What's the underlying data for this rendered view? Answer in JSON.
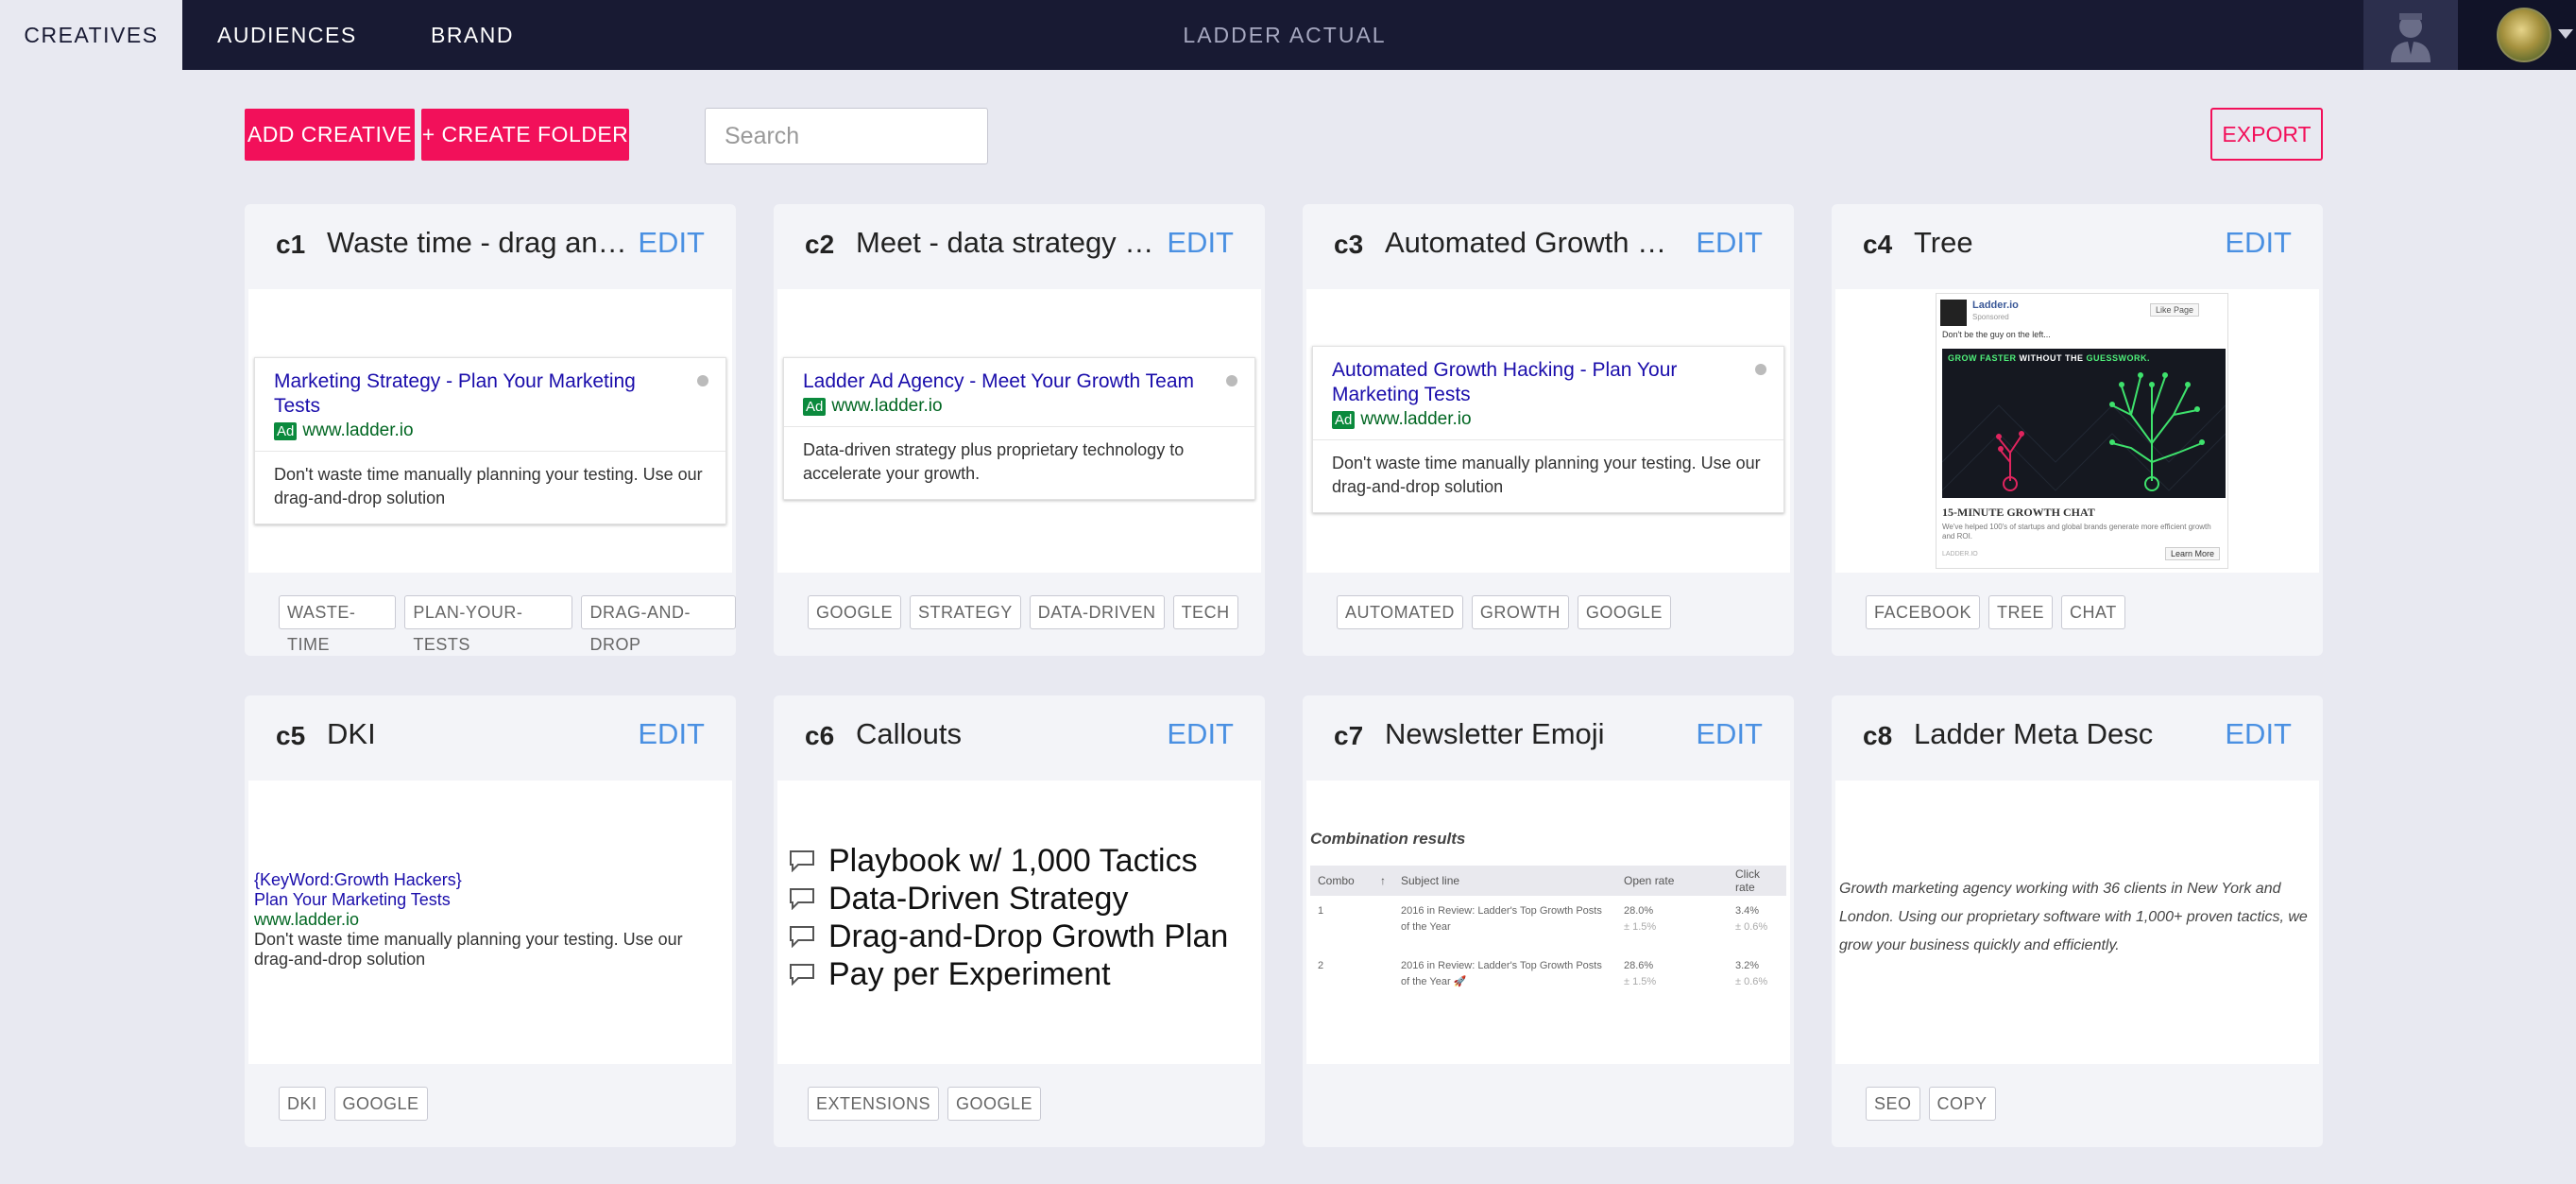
{
  "nav": {
    "tabs": [
      {
        "label": "CREATIVES",
        "active": true
      },
      {
        "label": "AUDIENCES",
        "active": false
      },
      {
        "label": "BRAND",
        "active": false
      }
    ],
    "account_name": "LADDER ACTUAL"
  },
  "toolbar": {
    "add_creative": "ADD CREATIVE",
    "create_folder": "+ CREATE FOLDER",
    "search_placeholder": "Search",
    "export": "EXPORT"
  },
  "colors": {
    "accent": "#f2105a",
    "nav_bg": "#181a33",
    "edit_link": "#4a90e2",
    "page_bg": "#e8e9f1"
  },
  "edit_label": "EDIT",
  "cards": [
    {
      "id": "c1",
      "title": "Waste time - drag and d...",
      "ad": {
        "title": "Marketing Strategy - Plan Your Marketing Tests",
        "badge": "Ad",
        "url": "www.ladder.io",
        "desc": "Don't waste time manually planning your testing. Use our drag-and-drop solution"
      },
      "tags": [
        "WASTE-TIME",
        "PLAN-YOUR-TESTS",
        "DRAG-AND-DROP"
      ]
    },
    {
      "id": "c2",
      "title": "Meet - data strategy te...",
      "ad": {
        "title": "Ladder Ad Agency - Meet Your Growth Team",
        "badge": "Ad",
        "url": "www.ladder.io",
        "desc": "Data-driven strategy plus proprietary technology to accelerate your growth."
      },
      "tags": [
        "GOOGLE",
        "STRATEGY",
        "DATA-DRIVEN",
        "TECH"
      ]
    },
    {
      "id": "c3",
      "title": "Automated Growth Hac...",
      "ad": {
        "title": "Automated Growth Hacking - Plan Your Marketing Tests",
        "badge": "Ad",
        "url": "www.ladder.io",
        "desc": "Don't waste time manually planning your testing. Use our drag-and-drop solution"
      },
      "tags": [
        "AUTOMATED",
        "GROWTH",
        "GOOGLE"
      ]
    },
    {
      "id": "c4",
      "title": "Tree",
      "fb": {
        "page_name": "Ladder.io",
        "sponsored": "Sponsored",
        "like_button": "Like Page",
        "text": "Don't be the guy on the left...",
        "image_text_green": "GROW FASTER",
        "image_text_white": " WITHOUT THE ",
        "image_text_green2": "GUESSWORK.",
        "headline": "15-MINUTE GROWTH CHAT",
        "subtext": "We've helped 100's of startups and global brands generate more efficient growth and ROI.",
        "footer": "LADDER.IO",
        "learn_more": "Learn More"
      },
      "tags": [
        "FACEBOOK",
        "TREE",
        "CHAT"
      ]
    },
    {
      "id": "c5",
      "title": "DKI",
      "dki": {
        "line1": "{KeyWord:Growth Hackers}",
        "line2": "Plan Your Marketing Tests",
        "line3": "www.ladder.io",
        "line4": "Don't waste time manually planning your testing. Use our drag-and-drop solution"
      },
      "tags": [
        "DKI",
        "GOOGLE"
      ]
    },
    {
      "id": "c6",
      "title": "Callouts",
      "callouts": [
        "Playbook w/ 1,000 Tactics",
        "Data-Driven Strategy",
        "Drag-and-Drop Growth Plan",
        "Pay per Experiment"
      ],
      "tags": [
        "EXTENSIONS",
        "GOOGLE"
      ]
    },
    {
      "id": "c7",
      "title": "Newsletter Emoji",
      "newsletter": {
        "heading": "Combination results",
        "columns": [
          "Combo",
          "Subject line",
          "Open rate",
          "Click rate"
        ],
        "rows": [
          {
            "combo": "1",
            "subject": "2016 in Review: Ladder's Top Growth Posts of the Year",
            "open": "28.0%",
            "open_sub": "± 1.5%",
            "click": "3.4%",
            "click_sub": "± 0.6%"
          },
          {
            "combo": "2",
            "subject": "2016 in Review: Ladder's Top Growth Posts of the Year 🚀",
            "open": "28.6%",
            "open_sub": "± 1.5%",
            "click": "3.2%",
            "click_sub": "± 0.6%"
          }
        ]
      },
      "tags": []
    },
    {
      "id": "c8",
      "title": "Ladder Meta Desc",
      "meta": "Growth marketing agency working with 36 clients in New York and London. Using our proprietary software with 1,000+ proven tactics, we grow your business quickly and efficiently.",
      "tags": [
        "SEO",
        "COPY"
      ]
    }
  ]
}
